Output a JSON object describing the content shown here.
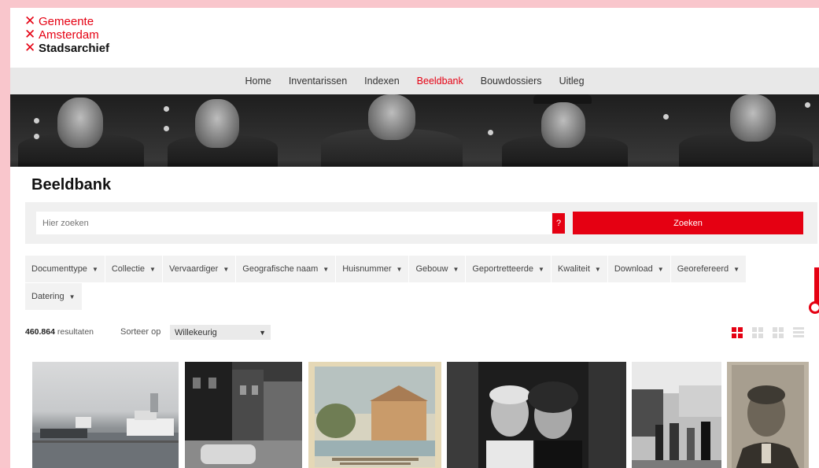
{
  "logo": {
    "lines": [
      "Gemeente",
      "Amsterdam",
      "Stadsarchief"
    ]
  },
  "nav": {
    "items": [
      "Home",
      "Inventarissen",
      "Indexen",
      "Beeldbank",
      "Bouwdossiers",
      "Uitleg"
    ],
    "active": "Beeldbank"
  },
  "page_title": "Beeldbank",
  "search": {
    "placeholder": "Hier zoeken",
    "help_label": "?",
    "button_label": "Zoeken"
  },
  "filters": {
    "row1": [
      "Documenttype",
      "Collectie",
      "Vervaardiger",
      "Geografische naam",
      "Huisnummer",
      "Gebouw",
      "Geportretteerde",
      "Kwaliteit",
      "Download",
      "Georefereerd"
    ],
    "row2": [
      "Datering"
    ]
  },
  "results": {
    "count": "460.864",
    "suffix": "resultaten",
    "sort_label": "Sorteer op",
    "sort_value": "Willekeurig"
  },
  "colors": {
    "accent": "#e50012",
    "background": "#f9c6cc"
  },
  "icons": [
    "chevron-down-icon",
    "grid-large-icon",
    "grid-medium-icon",
    "grid-small-icon",
    "list-icon"
  ]
}
